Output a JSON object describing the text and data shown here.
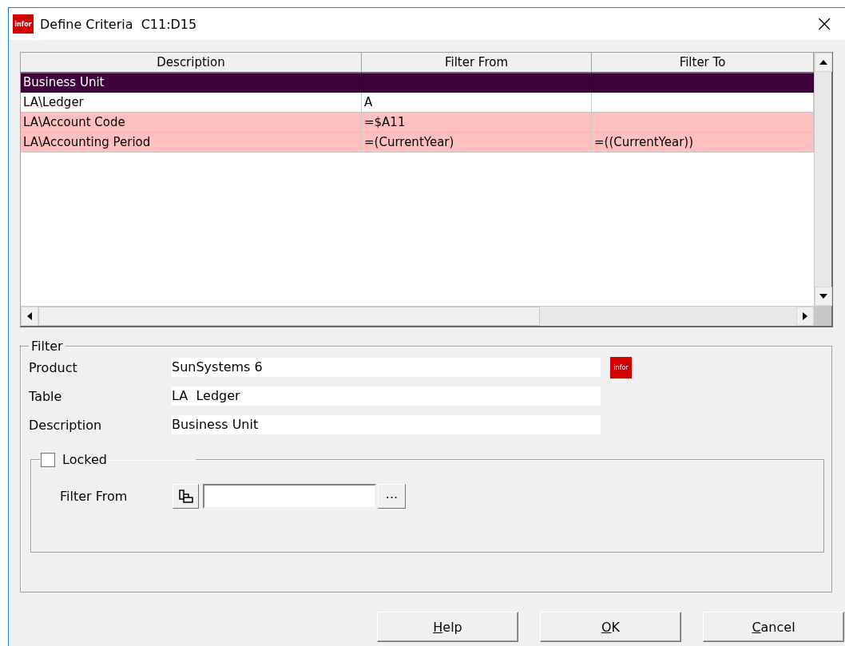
{
  "window": {
    "logo": "infor",
    "title": "Define Criteria  C11:D15",
    "close": "×"
  },
  "grid": {
    "columns": [
      "Description",
      "Filter From",
      "Filter To"
    ],
    "rows": [
      {
        "cells": [
          "Business Unit",
          "",
          ""
        ],
        "selected": true
      },
      {
        "cells": [
          "LA\\Ledger",
          "A",
          ""
        ],
        "selected": false,
        "highlighted": false
      },
      {
        "cells": [
          "LA\\Account Code",
          "=$A11",
          ""
        ],
        "selected": false,
        "highlighted": true
      },
      {
        "cells": [
          "LA\\Accounting Period",
          "=(CurrentYear)",
          "=((CurrentYear))"
        ],
        "selected": false,
        "highlighted": true
      }
    ]
  },
  "filter": {
    "title": "Filter",
    "fields": [
      {
        "label": "Product",
        "value": "SunSystems 6"
      },
      {
        "label": "Table",
        "value": "LA  Ledger"
      },
      {
        "label": "Description",
        "value": "Business Unit"
      }
    ],
    "product_logo": "infor",
    "locked": {
      "label": "Locked",
      "checked": false
    },
    "filter_from": {
      "label": "Filter From",
      "browse": "..."
    }
  },
  "buttons": [
    "Help",
    "OK",
    "Cancel"
  ]
}
